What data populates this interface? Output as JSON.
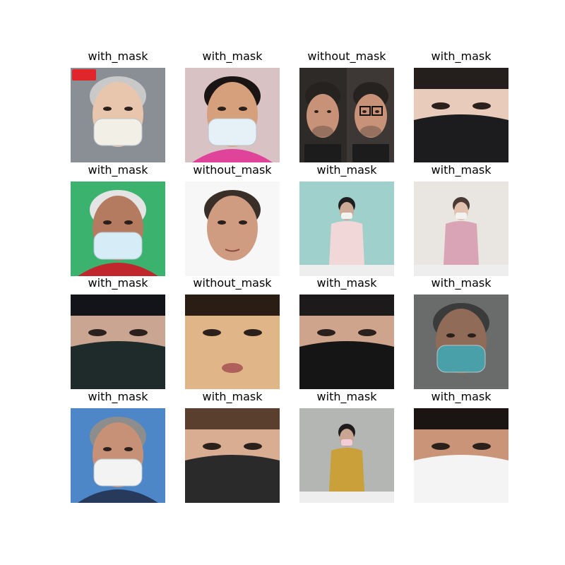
{
  "grid": {
    "rows": [
      [
        {
          "label": "with_mask",
          "bg": "#8a8f96",
          "tone": "#e8c5ad",
          "hair": "#c9c9c9",
          "mask": "#f2efe6",
          "badge": true
        },
        {
          "label": "with_mask",
          "bg": "#d9c2c4",
          "tone": "#d7a07c",
          "hair": "#1a1414",
          "mask": "#e6f1f7",
          "shirt": "#e0439a"
        },
        {
          "label": "without_mask",
          "bg": "#2e2a28",
          "tone": "#c89278",
          "hair": "#262220",
          "mask": null,
          "twin": true
        },
        {
          "label": "with_mask",
          "bg": "#f1f1f1",
          "tone": "#e9cbbb",
          "hair": "#241e1d",
          "mask": "#1c1c1e",
          "close": true
        }
      ],
      [
        {
          "label": "with_mask",
          "bg": "#3bb36e",
          "tone": "#b57b60",
          "hair": "#e4e4e4",
          "mask": "#d6ecf6",
          "shirt": "#c0262b"
        },
        {
          "label": "without_mask",
          "bg": "#f7f7f7",
          "tone": "#cf9c82",
          "hair": "#3a2e28",
          "mask": null
        },
        {
          "label": "with_mask",
          "bg": "#9fd0cb",
          "tone": "#ccaa95",
          "hair": "#1f1f22",
          "mask": "#f2f2f2",
          "shirt": "#f2d7d8",
          "small": true
        },
        {
          "label": "with_mask",
          "bg": "#e9e6e1",
          "tone": "#e2c2ae",
          "hair": "#4a3a34",
          "mask": "#f2f2f2",
          "shirt": "#d8a4b6",
          "small": true
        }
      ],
      [
        {
          "label": "with_mask",
          "bg": "#d9dde3",
          "tone": "#caa591",
          "hair": "#12141a",
          "mask": "#1f2a2a",
          "close": true
        },
        {
          "label": "without_mask",
          "bg": "#1a1510",
          "tone": "#e0b688",
          "hair": "#2a1d13",
          "mask": null,
          "close": true
        },
        {
          "label": "with_mask",
          "bg": "#cfd3d8",
          "tone": "#cfa48c",
          "hair": "#1c1a1a",
          "mask": "#151515",
          "close": true
        },
        {
          "label": "with_mask",
          "bg": "#6a6c6b",
          "tone": "#8f6b58",
          "hair": "#3b3b3b",
          "mask": "#4aa0a8"
        }
      ],
      [
        {
          "label": "with_mask",
          "bg": "#4d87c8",
          "tone": "#c79178",
          "hair": "#8d8d8d",
          "mask": "#f3f3f3",
          "shirt": "#273a5c"
        },
        {
          "label": "with_mask",
          "bg": "#d7bfa9",
          "tone": "#d9ad91",
          "hair": "#5a3e2e",
          "mask": "#2a2a2b",
          "close": true
        },
        {
          "label": "with_mask",
          "bg": "#b4b6b4",
          "tone": "#c9a592",
          "hair": "#1e1c1c",
          "mask": "#f3ccd8",
          "shirt": "#c9a03a",
          "small": true
        },
        {
          "label": "with_mask",
          "bg": "#c59a7f",
          "tone": "#c99478",
          "hair": "#1a1412",
          "mask": "#f4f4f4",
          "close": true
        }
      ]
    ]
  }
}
